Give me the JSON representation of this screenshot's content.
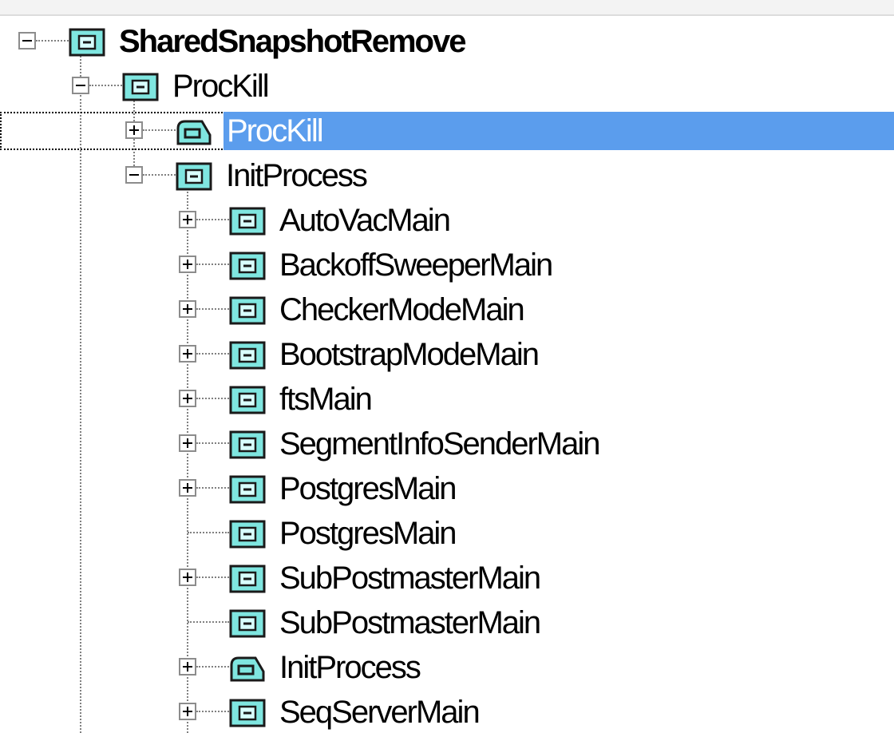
{
  "tree": {
    "nodes": [
      {
        "label": "SharedSnapshotRemove",
        "level": 0,
        "expander": "minus",
        "icon": "function-icon",
        "bold": true,
        "selected": false
      },
      {
        "label": "ProcKill",
        "level": 1,
        "expander": "minus",
        "icon": "function-icon",
        "bold": false,
        "selected": false
      },
      {
        "label": "ProcKill",
        "level": 2,
        "expander": "plus",
        "icon": "recursive-function-icon",
        "bold": false,
        "selected": true
      },
      {
        "label": "InitProcess",
        "level": 2,
        "expander": "minus",
        "icon": "function-icon",
        "bold": false,
        "selected": false
      },
      {
        "label": "AutoVacMain",
        "level": 3,
        "expander": "plus",
        "icon": "function-icon",
        "bold": false,
        "selected": false
      },
      {
        "label": "BackoffSweeperMain",
        "level": 3,
        "expander": "plus",
        "icon": "function-icon",
        "bold": false,
        "selected": false
      },
      {
        "label": "CheckerModeMain",
        "level": 3,
        "expander": "plus",
        "icon": "function-icon",
        "bold": false,
        "selected": false
      },
      {
        "label": "BootstrapModeMain",
        "level": 3,
        "expander": "plus",
        "icon": "function-icon",
        "bold": false,
        "selected": false
      },
      {
        "label": "ftsMain",
        "level": 3,
        "expander": "plus",
        "icon": "function-icon",
        "bold": false,
        "selected": false
      },
      {
        "label": "SegmentInfoSenderMain",
        "level": 3,
        "expander": "plus",
        "icon": "function-icon",
        "bold": false,
        "selected": false
      },
      {
        "label": "PostgresMain",
        "level": 3,
        "expander": "plus",
        "icon": "function-icon",
        "bold": false,
        "selected": false
      },
      {
        "label": "PostgresMain",
        "level": 3,
        "expander": "none",
        "icon": "function-icon",
        "bold": false,
        "selected": false
      },
      {
        "label": "SubPostmasterMain",
        "level": 3,
        "expander": "plus",
        "icon": "function-icon",
        "bold": false,
        "selected": false
      },
      {
        "label": "SubPostmasterMain",
        "level": 3,
        "expander": "none",
        "icon": "function-icon",
        "bold": false,
        "selected": false
      },
      {
        "label": "InitProcess",
        "level": 3,
        "expander": "plus",
        "icon": "recursive-function-icon",
        "bold": false,
        "selected": false
      },
      {
        "label": "SeqServerMain",
        "level": 3,
        "expander": "plus",
        "icon": "function-icon",
        "bold": false,
        "selected": false
      }
    ]
  },
  "colors": {
    "selection_bg": "#5b9ded",
    "selection_text": "#ffffff",
    "icon_fill": "#7fe6e0",
    "icon_border": "#1a1a1a",
    "connector": "#808080"
  }
}
